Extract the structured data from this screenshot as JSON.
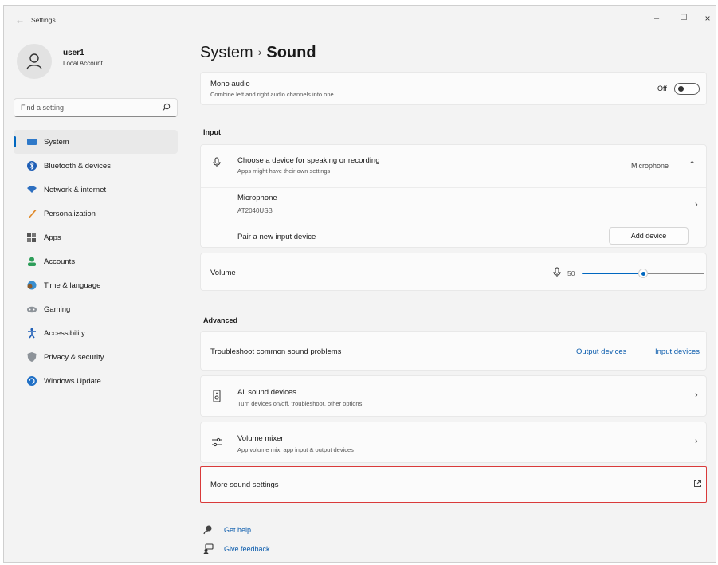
{
  "window": {
    "title": "Settings",
    "controls": {
      "minimize": "–",
      "maximize": "☐",
      "close": "×"
    }
  },
  "user": {
    "name": "user1",
    "account_type": "Local Account"
  },
  "search": {
    "placeholder": "Find a setting"
  },
  "sidebar": {
    "items": [
      {
        "label": "System",
        "icon": "system-icon",
        "active": true
      },
      {
        "label": "Bluetooth & devices",
        "icon": "bluetooth-icon"
      },
      {
        "label": "Network & internet",
        "icon": "wifi-icon"
      },
      {
        "label": "Personalization",
        "icon": "brush-icon"
      },
      {
        "label": "Apps",
        "icon": "apps-icon"
      },
      {
        "label": "Accounts",
        "icon": "accounts-icon"
      },
      {
        "label": "Time & language",
        "icon": "globe-clock-icon"
      },
      {
        "label": "Gaming",
        "icon": "gamepad-icon"
      },
      {
        "label": "Accessibility",
        "icon": "accessibility-icon"
      },
      {
        "label": "Privacy & security",
        "icon": "shield-icon"
      },
      {
        "label": "Windows Update",
        "icon": "update-icon"
      }
    ]
  },
  "breadcrumb": {
    "parent": "System",
    "separator": "›",
    "current": "Sound"
  },
  "mono_audio": {
    "title": "Mono audio",
    "subtitle": "Combine left and right audio channels into one",
    "state_label": "Off",
    "enabled": false
  },
  "input": {
    "section_title": "Input",
    "choose_device": {
      "title": "Choose a device for speaking or recording",
      "subtitle": "Apps might have their own settings",
      "selected": "Microphone"
    },
    "device": {
      "name": "Microphone",
      "model": "AT2040USB"
    },
    "pair": {
      "label": "Pair a new input device",
      "button": "Add device"
    },
    "volume": {
      "label": "Volume",
      "value": "50",
      "level": 0.5
    }
  },
  "advanced": {
    "section_title": "Advanced",
    "troubleshoot": {
      "label": "Troubleshoot common sound problems",
      "link_output": "Output devices",
      "link_input": "Input devices"
    },
    "all_devices": {
      "title": "All sound devices",
      "subtitle": "Turn devices on/off, troubleshoot, other options"
    },
    "mixer": {
      "title": "Volume mixer",
      "subtitle": "App volume mix, app input & output devices"
    },
    "more": {
      "label": "More sound settings"
    }
  },
  "help": {
    "get_help": "Get help",
    "feedback": "Give feedback"
  },
  "colors": {
    "accent": "#0067c0",
    "highlight": "#d93a3a",
    "link": "#0b5cad"
  }
}
